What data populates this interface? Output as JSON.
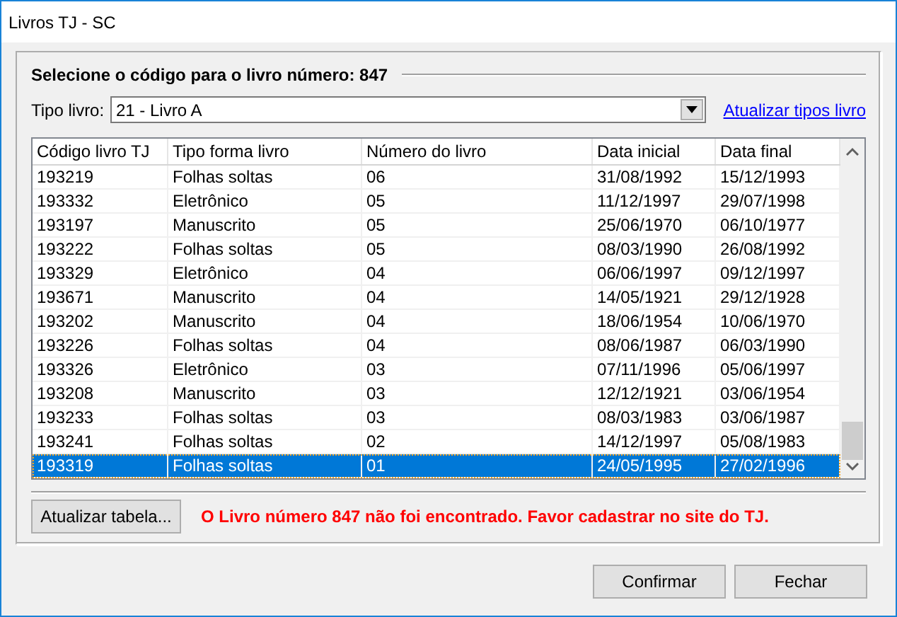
{
  "window": {
    "title": "Livros TJ - SC"
  },
  "heading": "Selecione o código para o livro número: 847",
  "tipo_livro": {
    "label": "Tipo livro:",
    "value": "21 - Livro A"
  },
  "refresh_types_link": "Atualizar tipos livro",
  "table": {
    "columns": [
      "Código livro TJ",
      "Tipo forma livro",
      "Número do livro",
      "Data inicial",
      "Data final"
    ],
    "rows": [
      {
        "cells": [
          "193219",
          "Folhas soltas",
          "06",
          "31/08/1992",
          "15/12/1993"
        ],
        "selected": false
      },
      {
        "cells": [
          "193332",
          "Eletrônico",
          "05",
          "11/12/1997",
          "29/07/1998"
        ],
        "selected": false
      },
      {
        "cells": [
          "193197",
          "Manuscrito",
          "05",
          "25/06/1970",
          "06/10/1977"
        ],
        "selected": false
      },
      {
        "cells": [
          "193222",
          "Folhas soltas",
          "05",
          "08/03/1990",
          "26/08/1992"
        ],
        "selected": false
      },
      {
        "cells": [
          "193329",
          "Eletrônico",
          "04",
          "06/06/1997",
          "09/12/1997"
        ],
        "selected": false
      },
      {
        "cells": [
          "193671",
          "Manuscrito",
          "04",
          "14/05/1921",
          "29/12/1928"
        ],
        "selected": false
      },
      {
        "cells": [
          "193202",
          "Manuscrito",
          "04",
          "18/06/1954",
          "10/06/1970"
        ],
        "selected": false
      },
      {
        "cells": [
          "193226",
          "Folhas soltas",
          "04",
          "08/06/1987",
          "06/03/1990"
        ],
        "selected": false
      },
      {
        "cells": [
          "193326",
          "Eletrônico",
          "03",
          "07/11/1996",
          "05/06/1997"
        ],
        "selected": false
      },
      {
        "cells": [
          "193208",
          "Manuscrito",
          "03",
          "12/12/1921",
          "03/06/1954"
        ],
        "selected": false
      },
      {
        "cells": [
          "193233",
          "Folhas soltas",
          "03",
          "08/03/1983",
          "03/06/1987"
        ],
        "selected": false
      },
      {
        "cells": [
          "193241",
          "Folhas soltas",
          "02",
          "14/12/1997",
          "05/08/1983"
        ],
        "selected": false
      },
      {
        "cells": [
          "193319",
          "Folhas soltas",
          "01",
          "24/05/1995",
          "27/02/1996"
        ],
        "selected": true
      }
    ]
  },
  "refresh_table_button": "Atualizar tabela...",
  "error_message": "O Livro número 847 não foi encontrado. Favor cadastrar no site do TJ.",
  "buttons": [
    "Confirmar",
    "Fechar"
  ]
}
